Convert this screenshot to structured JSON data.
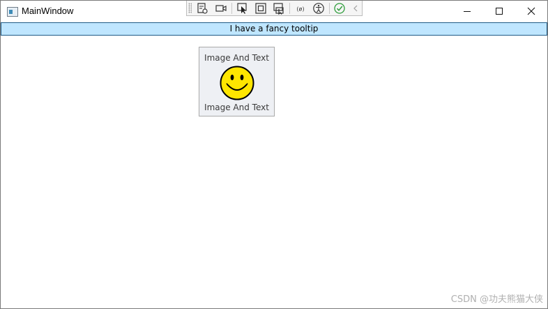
{
  "window": {
    "title": "MainWindow",
    "controls": {
      "minimize_icon": "minimize-icon",
      "maximize_icon": "maximize-icon",
      "close_icon": "close-icon"
    }
  },
  "debug_toolbar": {
    "icons": [
      "live-visual-tree-icon",
      "record-icon",
      "select-element-icon",
      "display-layout-adorners-icon",
      "track-focused-element-icon",
      "binding-failures-icon",
      "accessibility-icon",
      "check-icon",
      "collapse-icon"
    ]
  },
  "tooltip_bar": {
    "text": "I have a fancy tooltip"
  },
  "fancy_button": {
    "top_text": "Image And Text",
    "bottom_text": "Image And Text",
    "image_icon": "smiley-face-icon"
  },
  "watermark": {
    "text": "CSDN @功夫熊猫大侠"
  },
  "colors": {
    "tooltip_background": "#bfe6ff",
    "tooltip_border": "#1e5a86",
    "button_background": "#eef0f4",
    "smiley_fill": "#ffe600"
  }
}
